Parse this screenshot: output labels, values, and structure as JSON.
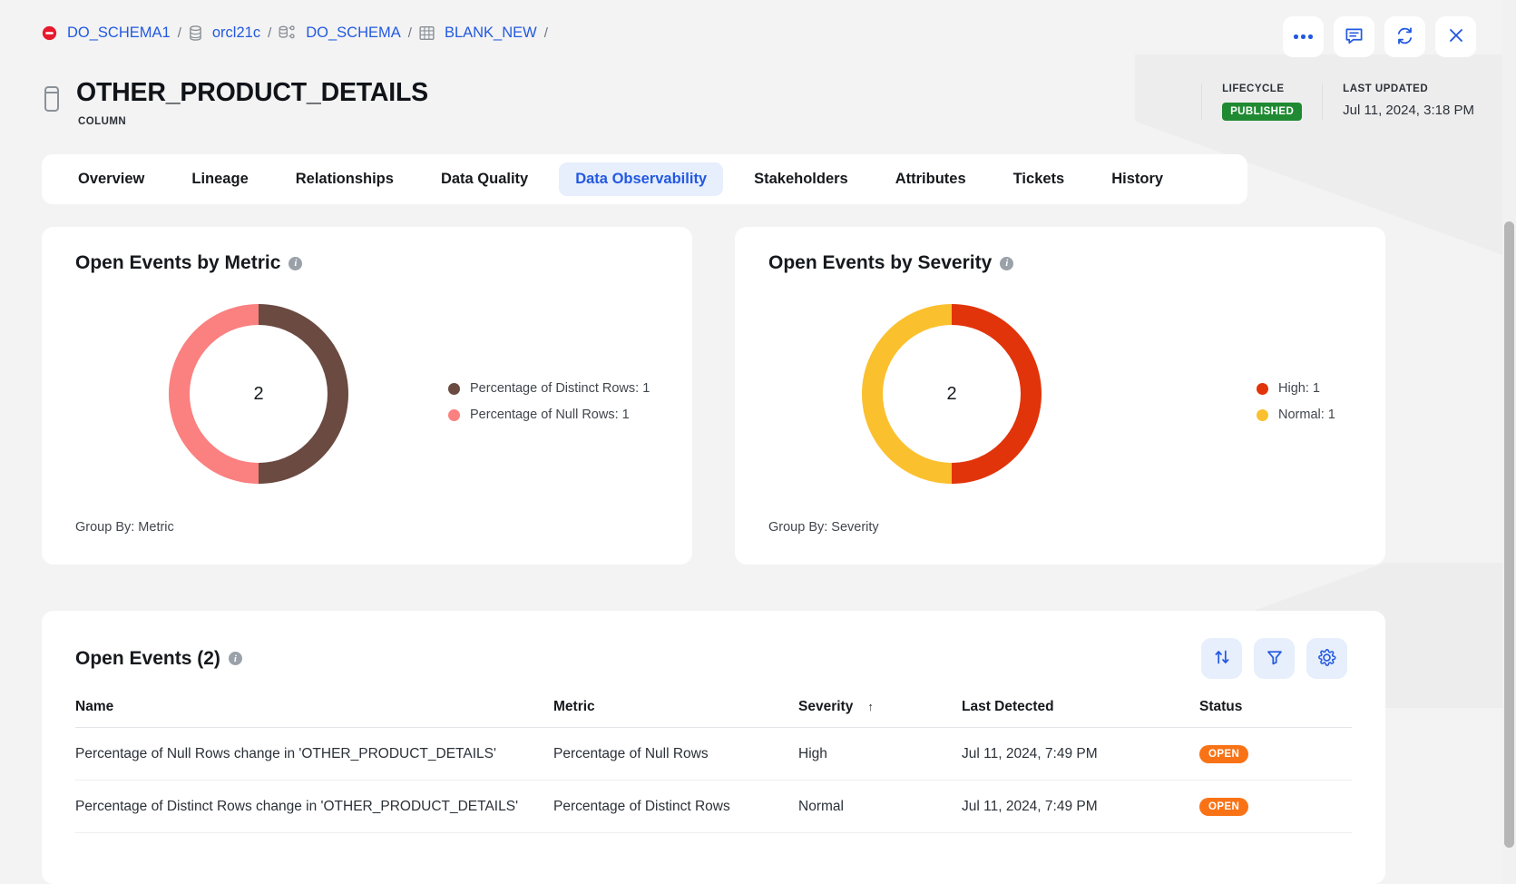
{
  "breadcrumb": {
    "items": [
      {
        "label": "DO_SCHEMA1",
        "icon": "no-entry-icon"
      },
      {
        "label": "orcl21c",
        "icon": "database-icon"
      },
      {
        "label": "DO_SCHEMA",
        "icon": "schema-icon"
      },
      {
        "label": "BLANK_NEW",
        "icon": "table-icon"
      }
    ],
    "separator": "/"
  },
  "window_actions": [
    {
      "name": "more-options-button",
      "icon": "ellipsis-icon"
    },
    {
      "name": "comments-button",
      "icon": "comment-icon"
    },
    {
      "name": "refresh-button",
      "icon": "refresh-icon"
    },
    {
      "name": "close-button",
      "icon": "close-icon"
    }
  ],
  "header": {
    "title": "OTHER_PRODUCT_DETAILS",
    "subtype": "COLUMN",
    "icon": "column-icon",
    "lifecycle_label": "LIFECYCLE",
    "lifecycle_value": "PUBLISHED",
    "last_updated_label": "LAST UPDATED",
    "last_updated_value": "Jul 11, 2024, 3:18 PM"
  },
  "tabs": [
    {
      "label": "Overview",
      "active": false
    },
    {
      "label": "Lineage",
      "active": false
    },
    {
      "label": "Relationships",
      "active": false
    },
    {
      "label": "Data Quality",
      "active": false
    },
    {
      "label": "Data Observability",
      "active": true
    },
    {
      "label": "Stakeholders",
      "active": false
    },
    {
      "label": "Attributes",
      "active": false
    },
    {
      "label": "Tickets",
      "active": false
    },
    {
      "label": "History",
      "active": false
    }
  ],
  "colors": {
    "link": "#2259e0",
    "accent_bg": "#e7eefc",
    "published_green": "#1f8a32",
    "open_orange": "#f97316",
    "metric_distinct": "#6b4a41",
    "metric_null": "#fb8080",
    "severity_high": "#e1340a",
    "severity_normal": "#fbc02d"
  },
  "chart_data": [
    {
      "type": "pie",
      "title": "Open Events by Metric",
      "center_total": "2",
      "group_by": "Group By: Metric",
      "legend_position": "right",
      "categories": [
        "Percentage of Distinct Rows",
        "Percentage of Null Rows"
      ],
      "values": [
        1,
        1
      ],
      "colors": [
        "#6b4a41",
        "#fb8080"
      ],
      "legend": [
        {
          "label": "Percentage of Distinct Rows: 1",
          "color": "#6b4a41"
        },
        {
          "label": "Percentage of Null Rows: 1",
          "color": "#fb8080"
        }
      ]
    },
    {
      "type": "pie",
      "title": "Open Events by Severity",
      "center_total": "2",
      "group_by": "Group By: Severity",
      "legend_position": "right",
      "categories": [
        "High",
        "Normal"
      ],
      "values": [
        1,
        1
      ],
      "colors": [
        "#e1340a",
        "#fbc02d"
      ],
      "legend": [
        {
          "label": "High: 1",
          "color": "#e1340a"
        },
        {
          "label": "Normal: 1",
          "color": "#fbc02d"
        }
      ]
    }
  ],
  "events": {
    "title": "Open Events (2)",
    "actions": [
      {
        "name": "sort-button",
        "icon": "sort-arrows-icon"
      },
      {
        "name": "filter-button",
        "icon": "funnel-icon"
      },
      {
        "name": "settings-button",
        "icon": "gear-icon"
      }
    ],
    "columns": [
      {
        "label": "Name",
        "sorted": false
      },
      {
        "label": "Metric",
        "sorted": false
      },
      {
        "label": "Severity",
        "sorted": true,
        "sort_dir": "↑"
      },
      {
        "label": "Last Detected",
        "sorted": false
      },
      {
        "label": "Status",
        "sorted": false
      }
    ],
    "rows": [
      {
        "name": "Percentage of Null Rows change in 'OTHER_PRODUCT_DETAILS'",
        "metric": "Percentage of Null Rows",
        "severity": "High",
        "last_detected": "Jul 11, 2024, 7:49 PM",
        "status": "OPEN"
      },
      {
        "name": "Percentage of Distinct Rows change in 'OTHER_PRODUCT_DETAILS'",
        "metric": "Percentage of Distinct Rows",
        "severity": "Normal",
        "last_detected": "Jul 11, 2024, 7:49 PM",
        "status": "OPEN"
      }
    ]
  }
}
